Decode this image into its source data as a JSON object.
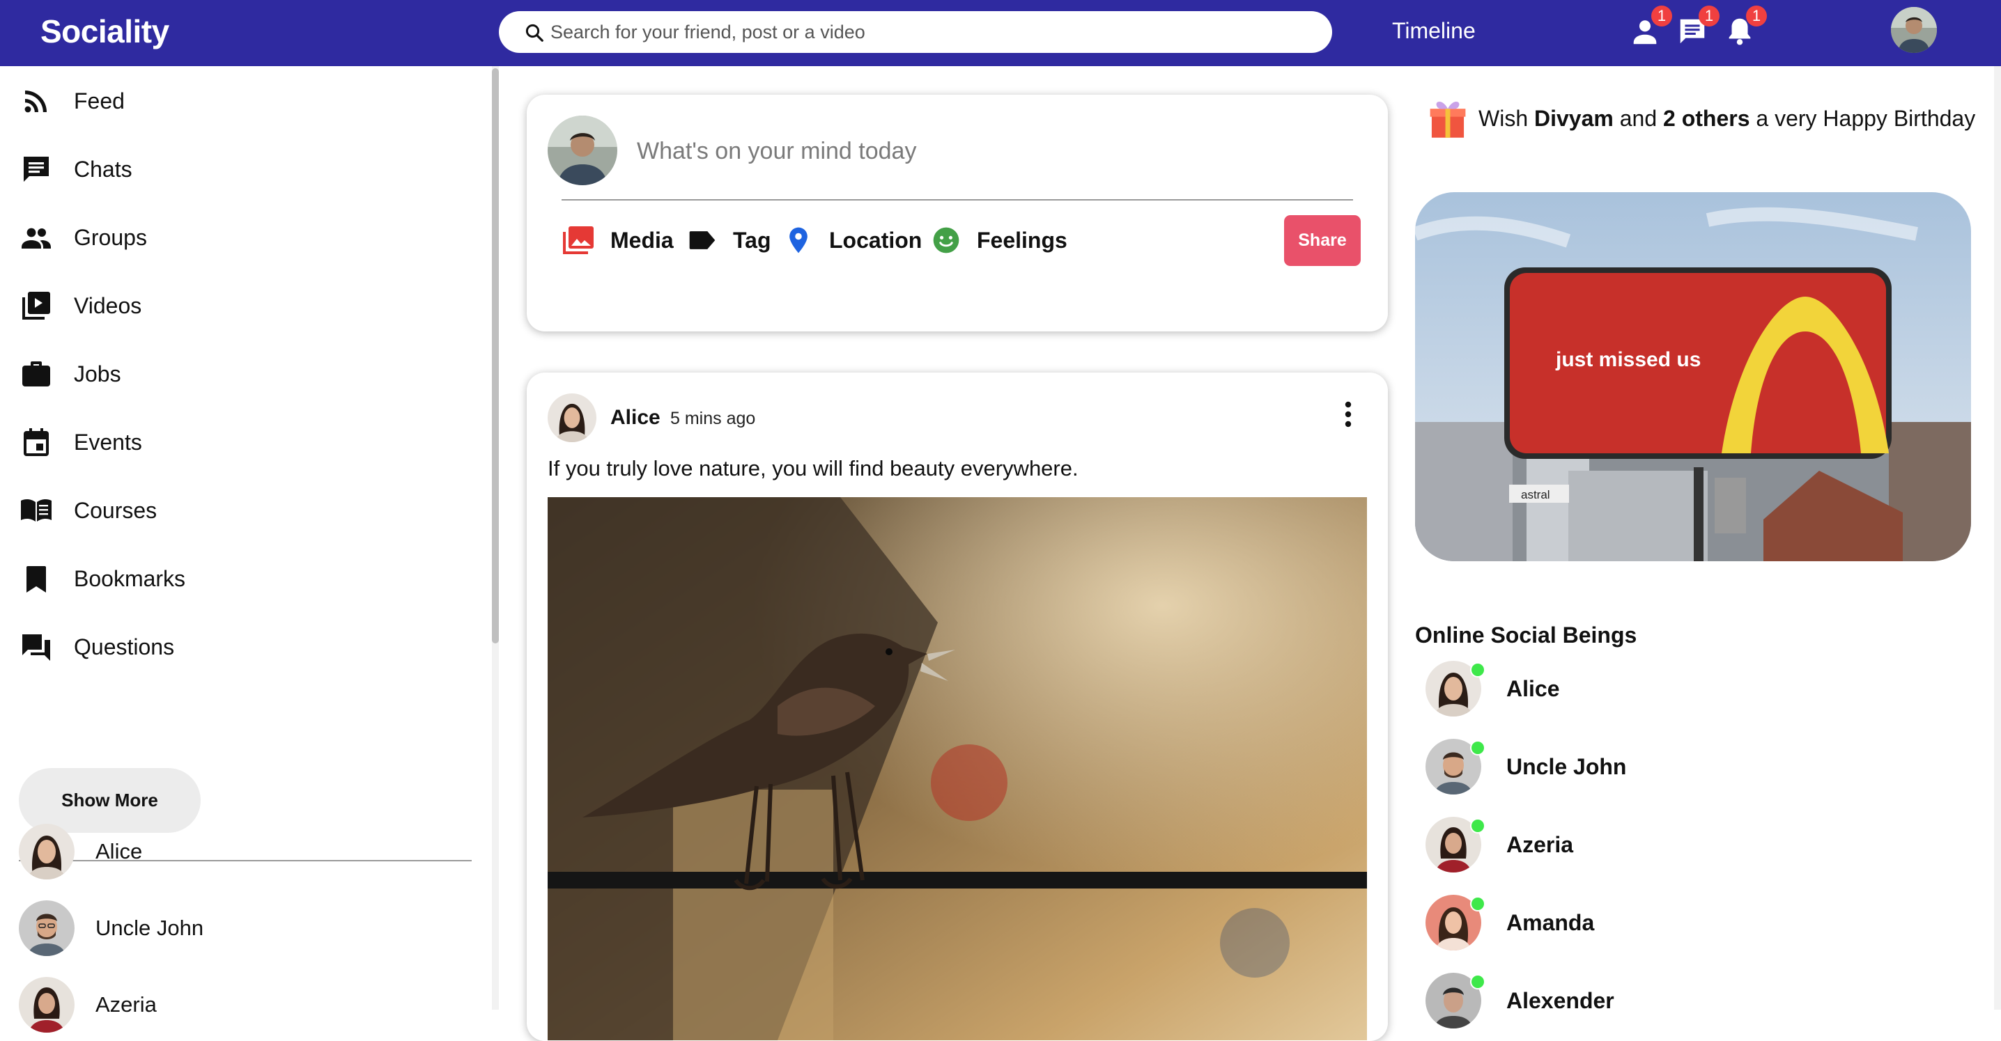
{
  "app": {
    "title": "Sociality"
  },
  "header": {
    "search_placeholder": "Search for your friend, post or a video",
    "timeline_link": "Timeline",
    "badges": {
      "friends": "1",
      "messages": "1",
      "notifications": "1"
    }
  },
  "sidebar": {
    "items": [
      {
        "label": "Feed",
        "icon": "rss-feed-icon"
      },
      {
        "label": "Chats",
        "icon": "chat-icon"
      },
      {
        "label": "Groups",
        "icon": "group-icon"
      },
      {
        "label": "Videos",
        "icon": "video-library-icon"
      },
      {
        "label": "Jobs",
        "icon": "briefcase-icon"
      },
      {
        "label": "Events",
        "icon": "calendar-icon"
      },
      {
        "label": "Courses",
        "icon": "book-icon"
      },
      {
        "label": "Bookmarks",
        "icon": "bookmark-icon"
      },
      {
        "label": "Questions",
        "icon": "question-forum-icon"
      }
    ],
    "show_more": "Show More",
    "friends": [
      "Alice",
      "Uncle John",
      "Azeria"
    ]
  },
  "share": {
    "placeholder": "What's on your mind today",
    "options": [
      "Media",
      "Tag",
      "Location",
      "Feelings"
    ],
    "share_button": "Share"
  },
  "post": {
    "user": "Alice",
    "time": "5 mins ago",
    "text": "If you truly love nature, you will find beauty everywhere."
  },
  "rightbar": {
    "birthday": {
      "prefix": "Wish ",
      "name": "Divyam",
      "middle": " and ",
      "others": "2 others",
      "suffix": " a very Happy Birthday"
    },
    "ad": {
      "billboard_text": "just missed us",
      "sign_text": "astral"
    },
    "online_title": "Online Social Beings",
    "online": [
      "Alice",
      "Uncle John",
      "Azeria",
      "Amanda",
      "Alexender"
    ]
  },
  "colors": {
    "header": "#2f2aa0",
    "share_button": "#e9516a",
    "online_dot": "#3ee84a",
    "badge": "#f04040"
  }
}
